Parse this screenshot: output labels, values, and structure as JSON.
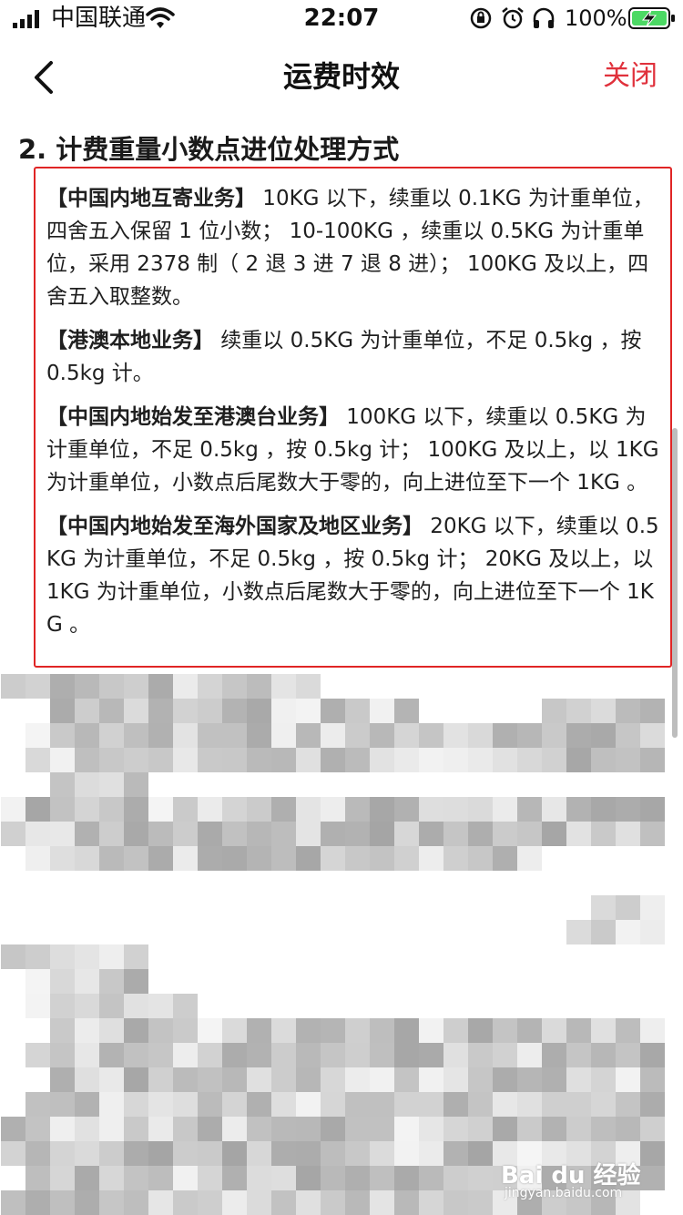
{
  "status_bar": {
    "carrier": "中国联通",
    "time": "22:07",
    "battery_percent": "100%",
    "icons": [
      "signal-icon",
      "wifi-icon",
      "orientation-lock-icon",
      "alarm-icon",
      "headphone-icon",
      "battery-charging-icon"
    ]
  },
  "nav": {
    "back_icon": "chevron-left-icon",
    "title": "运费时效",
    "close_label": "关闭",
    "close_color": "#e0313c"
  },
  "section": {
    "title": "2. 计费重量小数点进位处理方式",
    "highlight_color": "#e02525",
    "paragraphs": [
      {
        "label": "【中国内地互寄业务】",
        "text": " 10KG 以下，续重以 0.1KG 为计重单位，四舍五入保留 1 位小数； 10-100KG ，续重以 0.5KG 为计重单位，采用 2378 制（ 2 退 3 进 7 退 8 进）； 100KG 及以上，四舍五入取整数。"
      },
      {
        "label": "【港澳本地业务】",
        "text": " 续重以 0.5KG 为计重单位，不足 0.5kg ，按 0.5kg 计。"
      },
      {
        "label": "【中国内地始发至港澳台业务】",
        "text": " 100KG 以下，续重以 0.5KG 为计重单位，不足 0.5kg ，按 0.5kg 计； 100KG 及以上，以 1KG 为计重单位，小数点后尾数大于零的，向上进位至下一个 1KG 。"
      },
      {
        "label": "【中国内地始发至海外国家及地区业务】",
        "text": " 20KG 以下，续重以 0.5KG 为计重单位，不足 0.5kg ，按 0.5kg 计； 20KG 及以上，以 1KG 为计重单位，小数点后尾数大于零的，向上进位至下一个 1KG 。"
      }
    ]
  },
  "watermark": {
    "logo": "Bai du 经验",
    "url": "jingyan.baidu.com"
  }
}
